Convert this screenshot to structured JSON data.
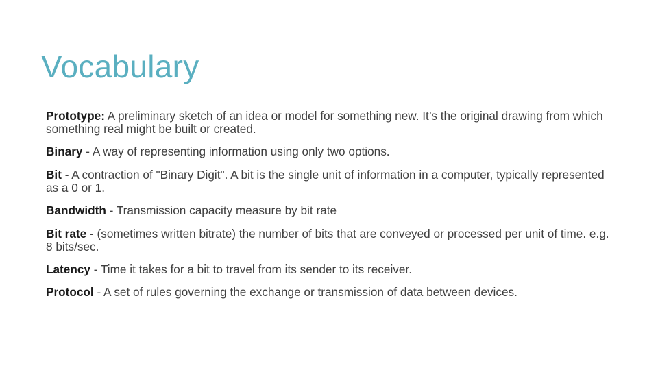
{
  "slide": {
    "title": "Vocabulary",
    "title_color": "#5aafc0",
    "entries": [
      {
        "term": "Prototype:",
        "separator": " ",
        "definition": "A preliminary sketch of an idea or model for something new. It’s the original drawing from which something real might be built or created."
      },
      {
        "term": "Binary",
        "separator": " - ",
        "definition": "A way of representing information using only two options."
      },
      {
        "term": "Bit",
        "separator": " - ",
        "definition": "A contraction of \"Binary Digit\". A bit is the single unit of information in a computer, typically represented as a 0 or 1."
      },
      {
        "term": "Bandwidth",
        "separator": " - ",
        "definition": "Transmission capacity measure by bit rate"
      },
      {
        "term": "Bit rate",
        "separator": " - ",
        "definition": "(sometimes written bitrate) the number of bits that are conveyed or processed per unit of time. e.g. 8 bits/sec."
      },
      {
        "term": "Latency",
        "separator": " - ",
        "definition": "Time it takes for a bit to travel from its sender to its receiver."
      },
      {
        "term": "Protocol",
        "separator": " - ",
        "definition": "A set of rules governing the exchange or transmission of data between devices."
      }
    ]
  }
}
